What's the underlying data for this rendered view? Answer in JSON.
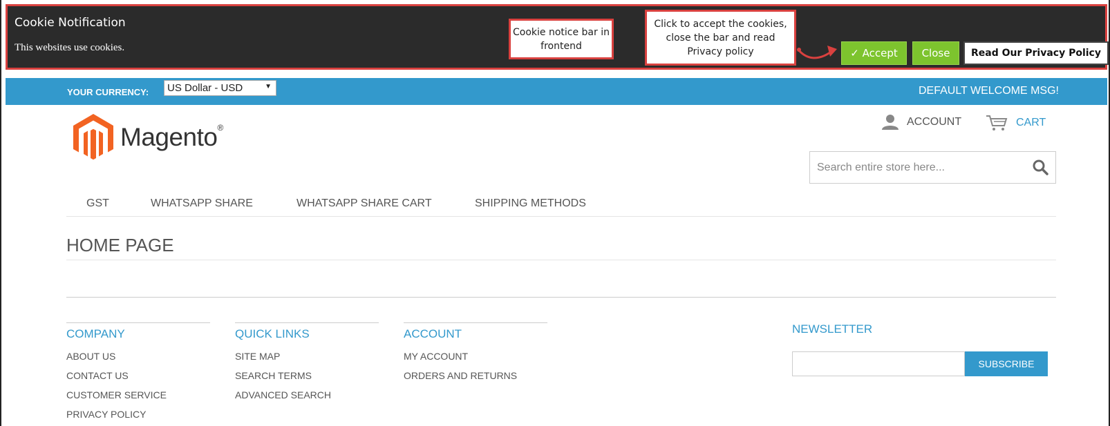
{
  "cookie_bar": {
    "title": "Cookie Notification",
    "message": "This websites use cookies.",
    "accept_label": "✓ Accept",
    "close_label": "Close",
    "privacy_label": "Read Our Privacy Policy"
  },
  "annotations": {
    "callout_1": "Cookie notice bar in frontend",
    "callout_2": "Click to accept the cookies, close the bar and read Privacy policy"
  },
  "header": {
    "currency_label": "YOUR CURRENCY:",
    "currency_value": "US Dollar - USD",
    "welcome": "DEFAULT WELCOME MSG!",
    "logo_text": "Magento",
    "logo_reg": "®",
    "account_label": "ACCOUNT",
    "cart_label": "CART",
    "search_placeholder": "Search entire store here..."
  },
  "nav": {
    "items": [
      "GST",
      "WHATSAPP SHARE",
      "WHATSAPP SHARE CART",
      "SHIPPING METHODS"
    ]
  },
  "page": {
    "title": "HOME PAGE"
  },
  "footer": {
    "columns": [
      {
        "heading": "COMPANY",
        "links": [
          "ABOUT US",
          "CONTACT US",
          "CUSTOMER SERVICE",
          "PRIVACY POLICY"
        ]
      },
      {
        "heading": "QUICK LINKS",
        "links": [
          "SITE MAP",
          "SEARCH TERMS",
          "ADVANCED SEARCH"
        ]
      },
      {
        "heading": "ACCOUNT",
        "links": [
          "MY ACCOUNT",
          "ORDERS AND RETURNS"
        ]
      }
    ],
    "newsletter": {
      "heading": "NEWSLETTER",
      "subscribe_label": "SUBSCRIBE"
    }
  },
  "colors": {
    "accent_blue": "#3399cc",
    "accept_green": "#7dc42e",
    "cookie_bg": "#2b2b2b",
    "annotation_red": "#d9413f",
    "logo_orange": "#f26322"
  }
}
